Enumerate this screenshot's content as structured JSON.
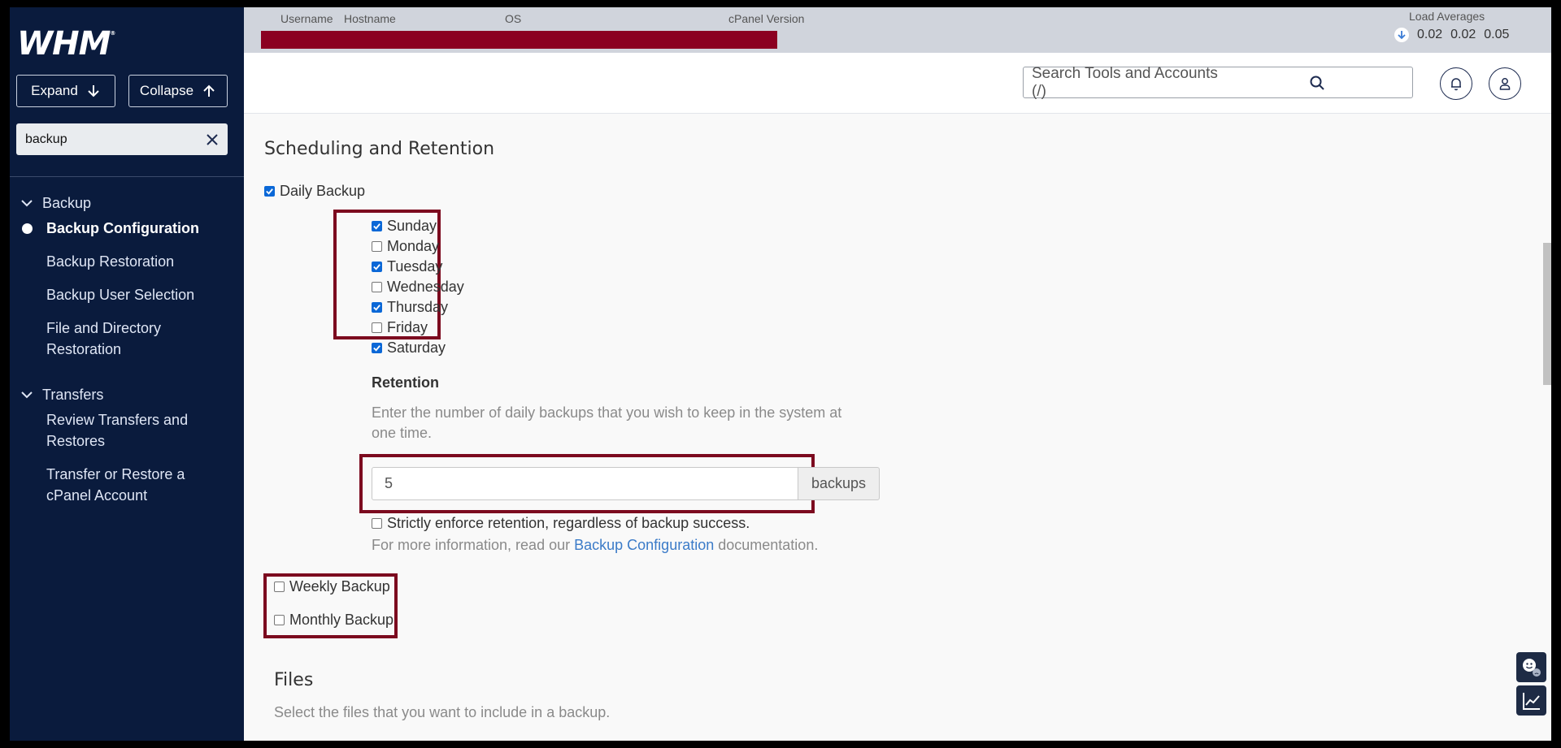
{
  "sidebar": {
    "logo": "WHM",
    "logo_mark": "®",
    "expand_label": "Expand",
    "collapse_label": "Collapse",
    "search_value": "backup",
    "sections": [
      {
        "label": "Backup",
        "items": [
          "Backup Configuration",
          "Backup Restoration",
          "Backup User Selection",
          "File and Directory Restoration"
        ]
      },
      {
        "label": "Transfers",
        "items": [
          "Review Transfers and Restores",
          "Transfer or Restore a cPanel Account"
        ]
      }
    ],
    "active_item": "Backup Configuration"
  },
  "topbar": {
    "headers": [
      "Username",
      "Hostname",
      "OS",
      "cPanel Version"
    ],
    "load_title": "Load Averages",
    "load_values": [
      "0.02",
      "0.02",
      "0.05"
    ],
    "redacted_color": "#8b0021"
  },
  "header": {
    "search_placeholder": "Search Tools and Accounts (/)"
  },
  "main": {
    "scheduling_title": "Scheduling and Retention",
    "daily_backup_label": "Daily Backup",
    "daily_backup_checked": true,
    "days": [
      {
        "label": "Sunday",
        "checked": true
      },
      {
        "label": "Monday",
        "checked": false
      },
      {
        "label": "Tuesday",
        "checked": true
      },
      {
        "label": "Wednesday",
        "checked": false
      },
      {
        "label": "Thursday",
        "checked": true
      },
      {
        "label": "Friday",
        "checked": false
      },
      {
        "label": "Saturday",
        "checked": true
      }
    ],
    "retention_title": "Retention",
    "retention_help_line1": "Enter the number of daily backups that you wish to keep in the system at",
    "retention_help_line2": "one time.",
    "retention_value": "5",
    "retention_unit": "backups",
    "strict_label": "Strictly enforce retention, regardless of backup success.",
    "more_info_prefix": "For more information, read our",
    "more_info_link": "Backup Configuration",
    "more_info_suffix": "documentation.",
    "weekly_label": "Weekly Backup",
    "monthly_label": "Monthly Backup",
    "files_title": "Files",
    "files_help": "Select the files that you want to include in a backup."
  },
  "colors": {
    "sidebar_bg": "#0a1b3d",
    "highlight_border": "#7c0a1f",
    "link": "#3b7bc8",
    "checkbox_checked": "#0b68d7"
  }
}
